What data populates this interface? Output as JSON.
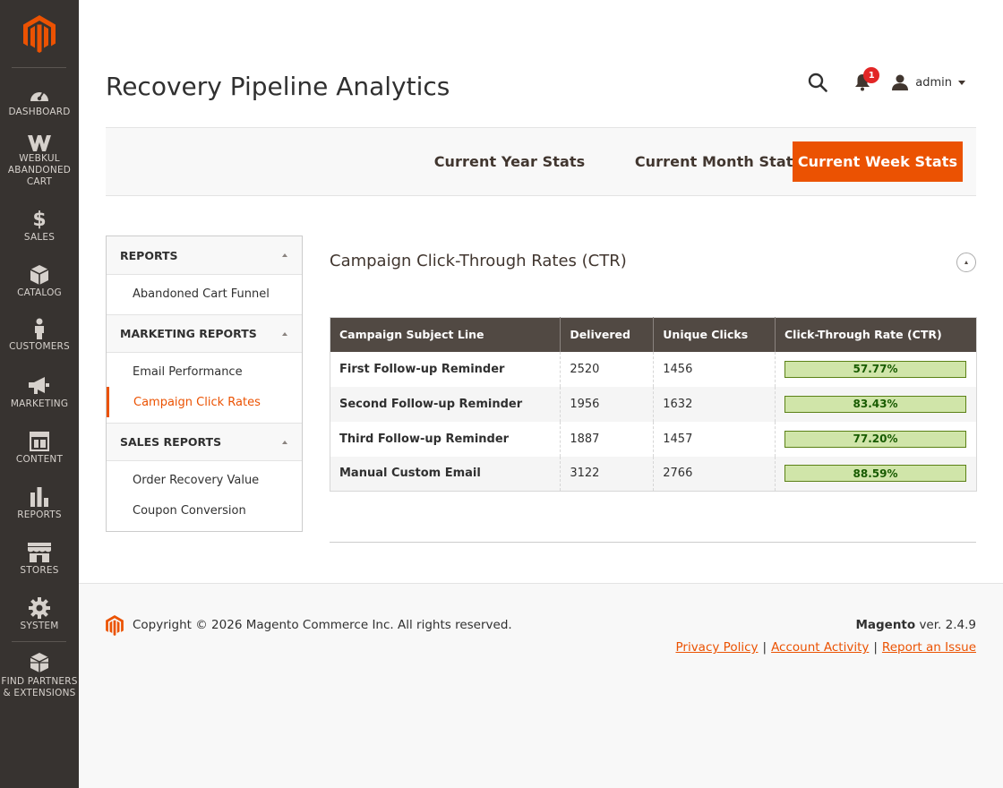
{
  "sidebar": {
    "items": [
      {
        "label": "DASHBOARD",
        "icon": "dashboard-icon"
      },
      {
        "label": "WEBKUL\nABANDONED\nCART",
        "icon": "webkul-icon"
      },
      {
        "label": "SALES",
        "icon": "dollar-icon"
      },
      {
        "label": "CATALOG",
        "icon": "box-icon"
      },
      {
        "label": "CUSTOMERS",
        "icon": "person-icon"
      },
      {
        "label": "MARKETING",
        "icon": "megaphone-icon"
      },
      {
        "label": "CONTENT",
        "icon": "layout-icon"
      },
      {
        "label": "REPORTS",
        "icon": "bar-chart-icon"
      },
      {
        "label": "STORES",
        "icon": "store-icon"
      },
      {
        "label": "SYSTEM",
        "icon": "gear-icon"
      },
      {
        "label": "FIND PARTNERS\n& EXTENSIONS",
        "icon": "blocks-icon"
      }
    ]
  },
  "header": {
    "title": "Recovery Pipeline Analytics",
    "notification_count": "1",
    "user": "admin"
  },
  "stats_tabs": {
    "year": "Current Year Stats",
    "month": "Current Month Stats",
    "week": "Current Week Stats",
    "active": "week"
  },
  "side_panel": {
    "reports_head": "REPORTS",
    "abandoned_funnel": "Abandoned Cart Funnel",
    "marketing_head": "MARKETING REPORTS",
    "email_performance": "Email Performance",
    "campaign_click_rates": "Campaign Click Rates",
    "sales_head": "SALES REPORTS",
    "order_recovery": "Order Recovery Value",
    "coupon_conversion": "Coupon Conversion"
  },
  "content": {
    "section_title": "Campaign Click-Through Rates (CTR)",
    "columns": [
      "Campaign Subject Line",
      "Delivered",
      "Unique Clicks",
      "Click-Through Rate (CTR)"
    ],
    "rows": [
      {
        "subject": "First Follow-up Reminder",
        "delivered": "2520",
        "clicks": "1456",
        "ctr": "57.77%"
      },
      {
        "subject": "Second Follow-up Reminder",
        "delivered": "1956",
        "clicks": "1632",
        "ctr": "83.43%"
      },
      {
        "subject": "Third Follow-up Reminder",
        "delivered": "1887",
        "clicks": "1457",
        "ctr": "77.20%"
      },
      {
        "subject": "Manual Custom Email",
        "delivered": "3122",
        "clicks": "2766",
        "ctr": "88.59%"
      }
    ]
  },
  "footer": {
    "copyright": "Copyright © 2026 Magento Commerce Inc. All rights reserved.",
    "brand": "Magento",
    "version": " ver. 2.4.9",
    "privacy": "Privacy Policy",
    "activity": " Account Activity",
    "report": "Report an Issue",
    "pipe": "|"
  },
  "colors": {
    "accent": "#eb5202",
    "sidebar_bg": "#373330",
    "table_header": "#514943",
    "ctr_fill": "#d0e5a9"
  }
}
